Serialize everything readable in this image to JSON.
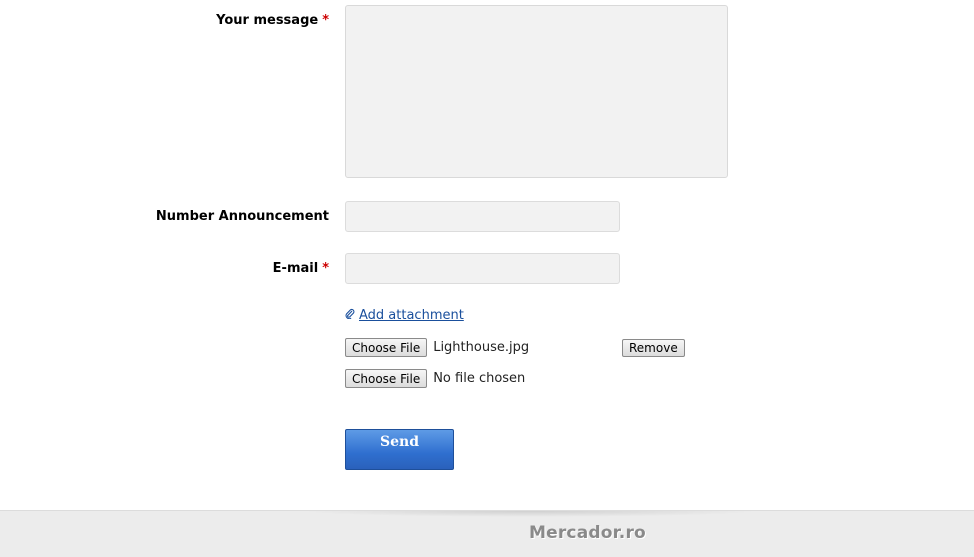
{
  "form": {
    "message_label": "Your message",
    "message_required": "*",
    "message_value": "",
    "announcement_label": "Number Announcement",
    "announcement_value": "",
    "email_label": "E-mail",
    "email_required": "*",
    "email_value": "",
    "add_attachment": "Add attachment",
    "attachment_icon": "paperclip-icon",
    "files": [
      {
        "button": "Choose File",
        "name": "Lighthouse.jpg",
        "remove": "Remove"
      },
      {
        "button": "Choose File",
        "name": "No file chosen"
      }
    ],
    "send_label": "Send"
  },
  "footer": {
    "brand": "Mercador.ro"
  },
  "colors": {
    "required": "#cc0000",
    "link": "#1a4f9c",
    "send_button": "#2f6fcf",
    "field_bg": "#f2f2f2",
    "footer_bg": "#ececec"
  }
}
